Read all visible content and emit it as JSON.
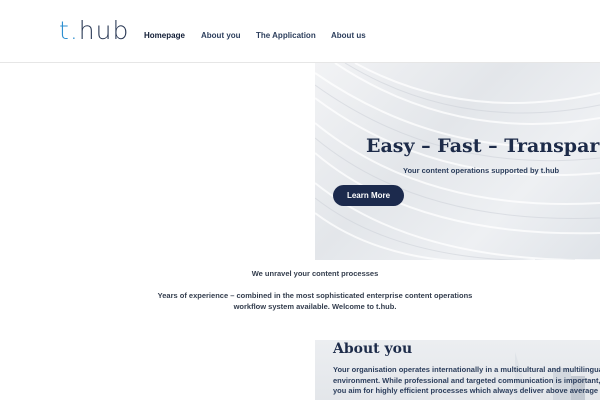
{
  "brand": {
    "logo_t": "t",
    "logo_dot": ".",
    "logo_rest": "hub"
  },
  "nav": {
    "items": [
      {
        "label": "Homepage",
        "active": true
      },
      {
        "label": "About you",
        "active": false
      },
      {
        "label": "The Application",
        "active": false
      },
      {
        "label": "About us",
        "active": false
      }
    ]
  },
  "hero": {
    "title": "Easy – Fast – Transparent",
    "subtitle": "Your content operations supported by t.hub",
    "button_label": "Learn More"
  },
  "intro": {
    "title": "We unravel your content processes",
    "line1": "Years of experience – combined in the most sophisticated enterprise content operations",
    "line2": "workflow system available. Welcome to t.hub."
  },
  "about": {
    "title": "About you",
    "line1": "Your organisation operates internationally in a multicultural and multilingual",
    "line2": "environment. While professional and targeted communication is important,",
    "line3": "you aim for highly efficient processes which always deliver above average"
  },
  "colors": {
    "navy": "#1c2a4d",
    "accent_blue": "#2d8fd0",
    "text": "#2c3e5c"
  }
}
